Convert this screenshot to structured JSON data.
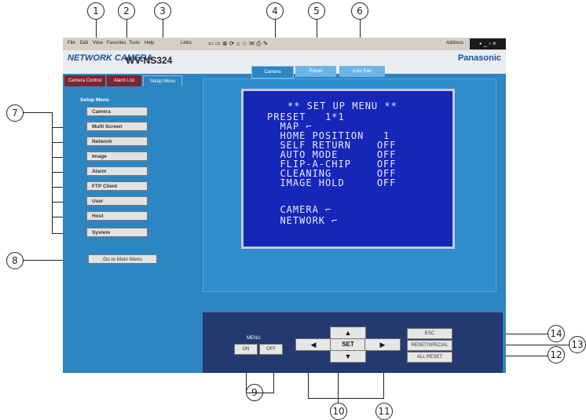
{
  "browser": {
    "menu_items": [
      "File",
      "Edit",
      "View",
      "Favorites",
      "Tools",
      "Help"
    ],
    "links_label": "Links",
    "address_label": "Address"
  },
  "header": {
    "logo_text": "NETWORK CAMERA",
    "model": "WV-NS324",
    "brand": "Panasonic"
  },
  "top_tabs": [
    "Camera Control",
    "Alarm List",
    "Setup Menu"
  ],
  "sub_tabs": [
    "Camera",
    "Preset",
    "Auto Pan"
  ],
  "setup_menu": {
    "title": "Setup Menu",
    "items": [
      "Camera",
      "Multi Screen",
      "Network",
      "Image",
      "Alarm",
      "FTP Client",
      "User",
      "Host",
      "System"
    ],
    "go_main": "Go to Main Menu"
  },
  "camera_menu": {
    "title": "** SET UP MENU **",
    "lines": [
      "PRESET   1*1",
      "  MAP ⌐",
      "  HOME POSITION   1",
      "  SELF RETURN    OFF",
      "  AUTO MODE      OFF",
      "  FLIP-A-CHIP    OFF",
      "  CLEANING       OFF",
      "  IMAGE HOLD     OFF",
      "",
      "  CAMERA ⌐",
      "  NETWORK ⌐"
    ]
  },
  "controls": {
    "menu_label": "MENU",
    "on": "ON",
    "off": "OFF",
    "set": "SET",
    "up": "▲",
    "down": "▼",
    "left": "◀",
    "right": "▶",
    "esc": "ESC",
    "reset_special": "RESET/SPECIAL",
    "all_reset": "ALL RESET"
  },
  "callouts": [
    "1",
    "2",
    "3",
    "4",
    "5",
    "6",
    "7",
    "8",
    "9",
    "10",
    "11",
    "12",
    "13",
    "14"
  ],
  "colors": {
    "panel_blue": "#2d86c4",
    "control_navy": "#23396f",
    "screen_blue": "#1626b8"
  }
}
